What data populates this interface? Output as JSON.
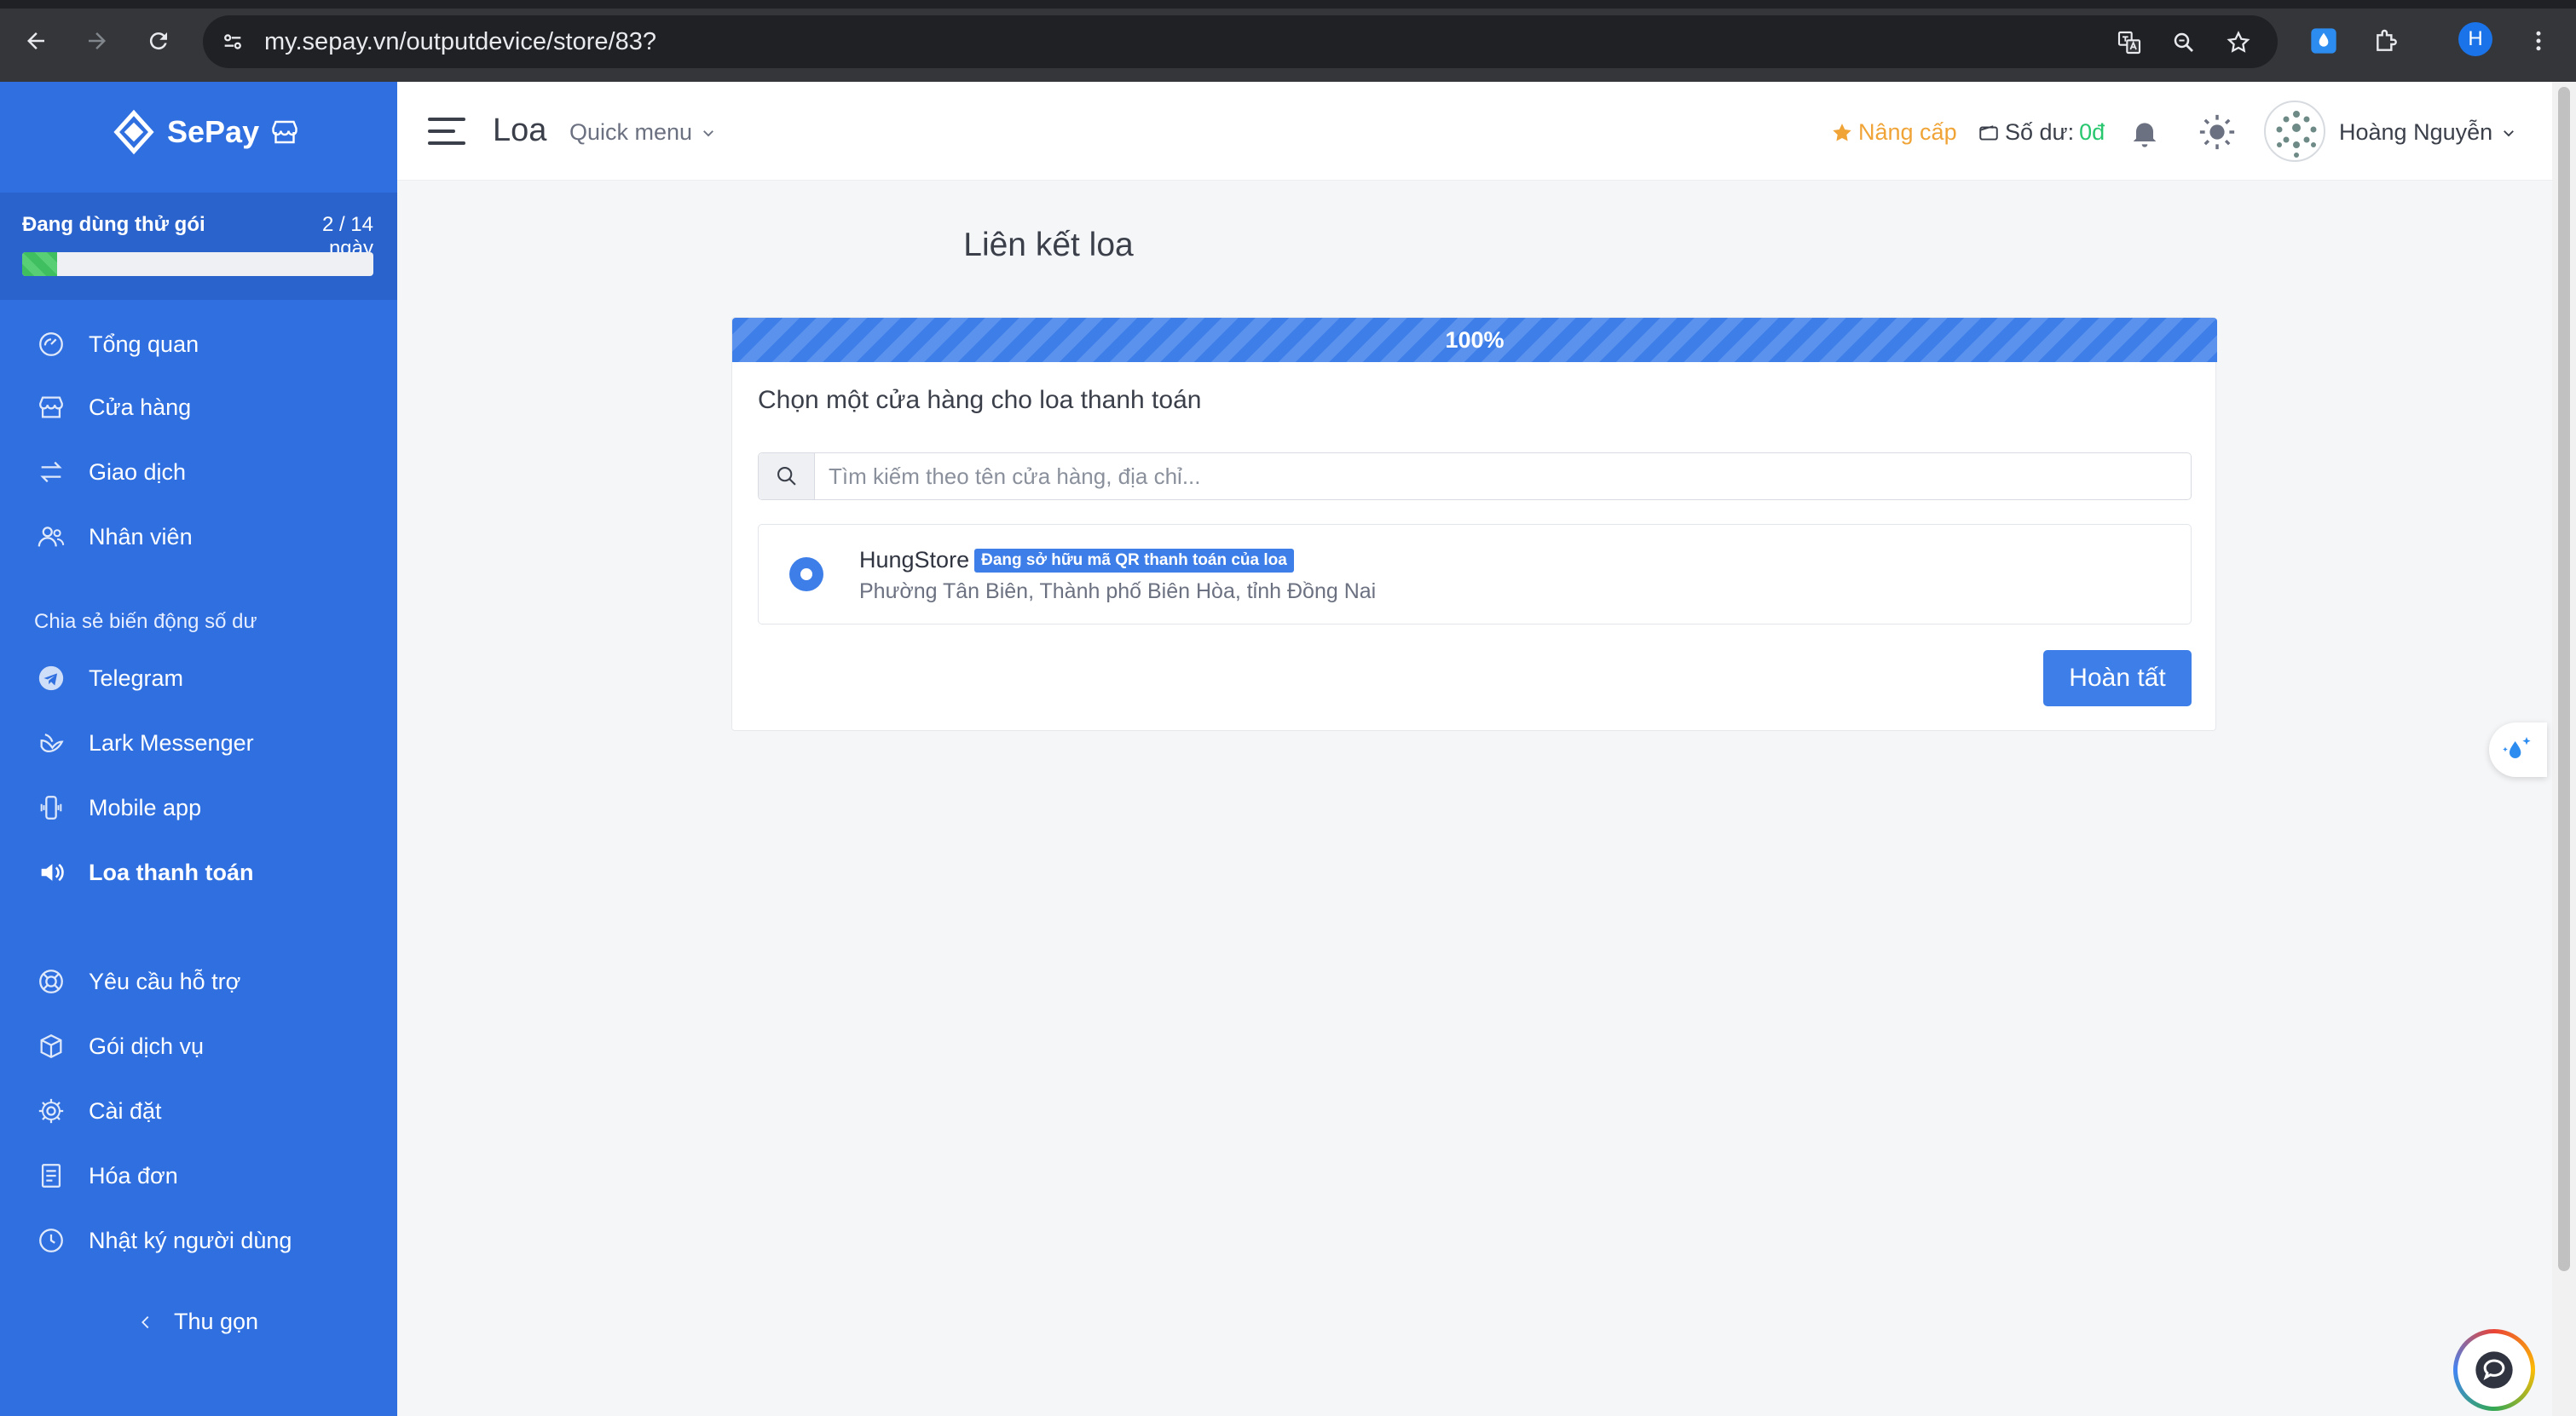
{
  "browser": {
    "url": "my.sepay.vn/outputdevice/store/83?",
    "profile_initial": "H"
  },
  "sidebar": {
    "brand": "SePay",
    "trial": {
      "label": "Đang dùng thử gói",
      "count": "2 / 14 ngày",
      "progress_fraction": 0.1
    },
    "items": [
      {
        "label": "Tổng quan",
        "icon": "dashboard-icon"
      },
      {
        "label": "Cửa hàng",
        "icon": "store-icon"
      },
      {
        "label": "Giao dịch",
        "icon": "transfer-icon"
      },
      {
        "label": "Nhân viên",
        "icon": "users-icon"
      }
    ],
    "section_label": "Chia sẻ biến động số dư",
    "share_items": [
      {
        "label": "Telegram",
        "icon": "telegram-icon"
      },
      {
        "label": "Lark Messenger",
        "icon": "lark-icon"
      },
      {
        "label": "Mobile app",
        "icon": "mobile-icon"
      },
      {
        "label": "Loa thanh toán",
        "icon": "speaker-icon"
      }
    ],
    "bottom_items": [
      {
        "label": "Yêu cầu hỗ trợ",
        "icon": "lifebuoy-icon"
      },
      {
        "label": "Gói dịch vụ",
        "icon": "package-icon"
      },
      {
        "label": "Cài đặt",
        "icon": "gear-icon"
      },
      {
        "label": "Hóa đơn",
        "icon": "invoice-icon"
      },
      {
        "label": "Nhật ký người dùng",
        "icon": "clock-icon"
      }
    ],
    "collapse_label": "Thu gọn"
  },
  "topbar": {
    "page_name": "Loa",
    "quick_menu": "Quick menu",
    "upgrade": "Nâng cấp",
    "balance_label": "Số dư:",
    "balance_value": "0đ",
    "user_name": "Hoàng Nguyễn"
  },
  "main": {
    "title": "Liên kết loa",
    "progress_label": "100%",
    "heading": "Chọn một cửa hàng cho loa thanh toán",
    "search_placeholder": "Tìm kiếm theo tên cửa hàng, địa chỉ...",
    "store": {
      "name": "HungStore",
      "badge": "Đang sở hữu mã QR thanh toán của loa",
      "address": "Phường Tân Biên, Thành phố Biên Hòa, tỉnh Đồng Nai",
      "selected": true
    },
    "finish_button": "Hoàn tất"
  },
  "colors": {
    "sidebar": "#2f6fe0",
    "primary": "#3e7ee8",
    "upgrade": "#f0a437",
    "balance": "#28c76f"
  }
}
